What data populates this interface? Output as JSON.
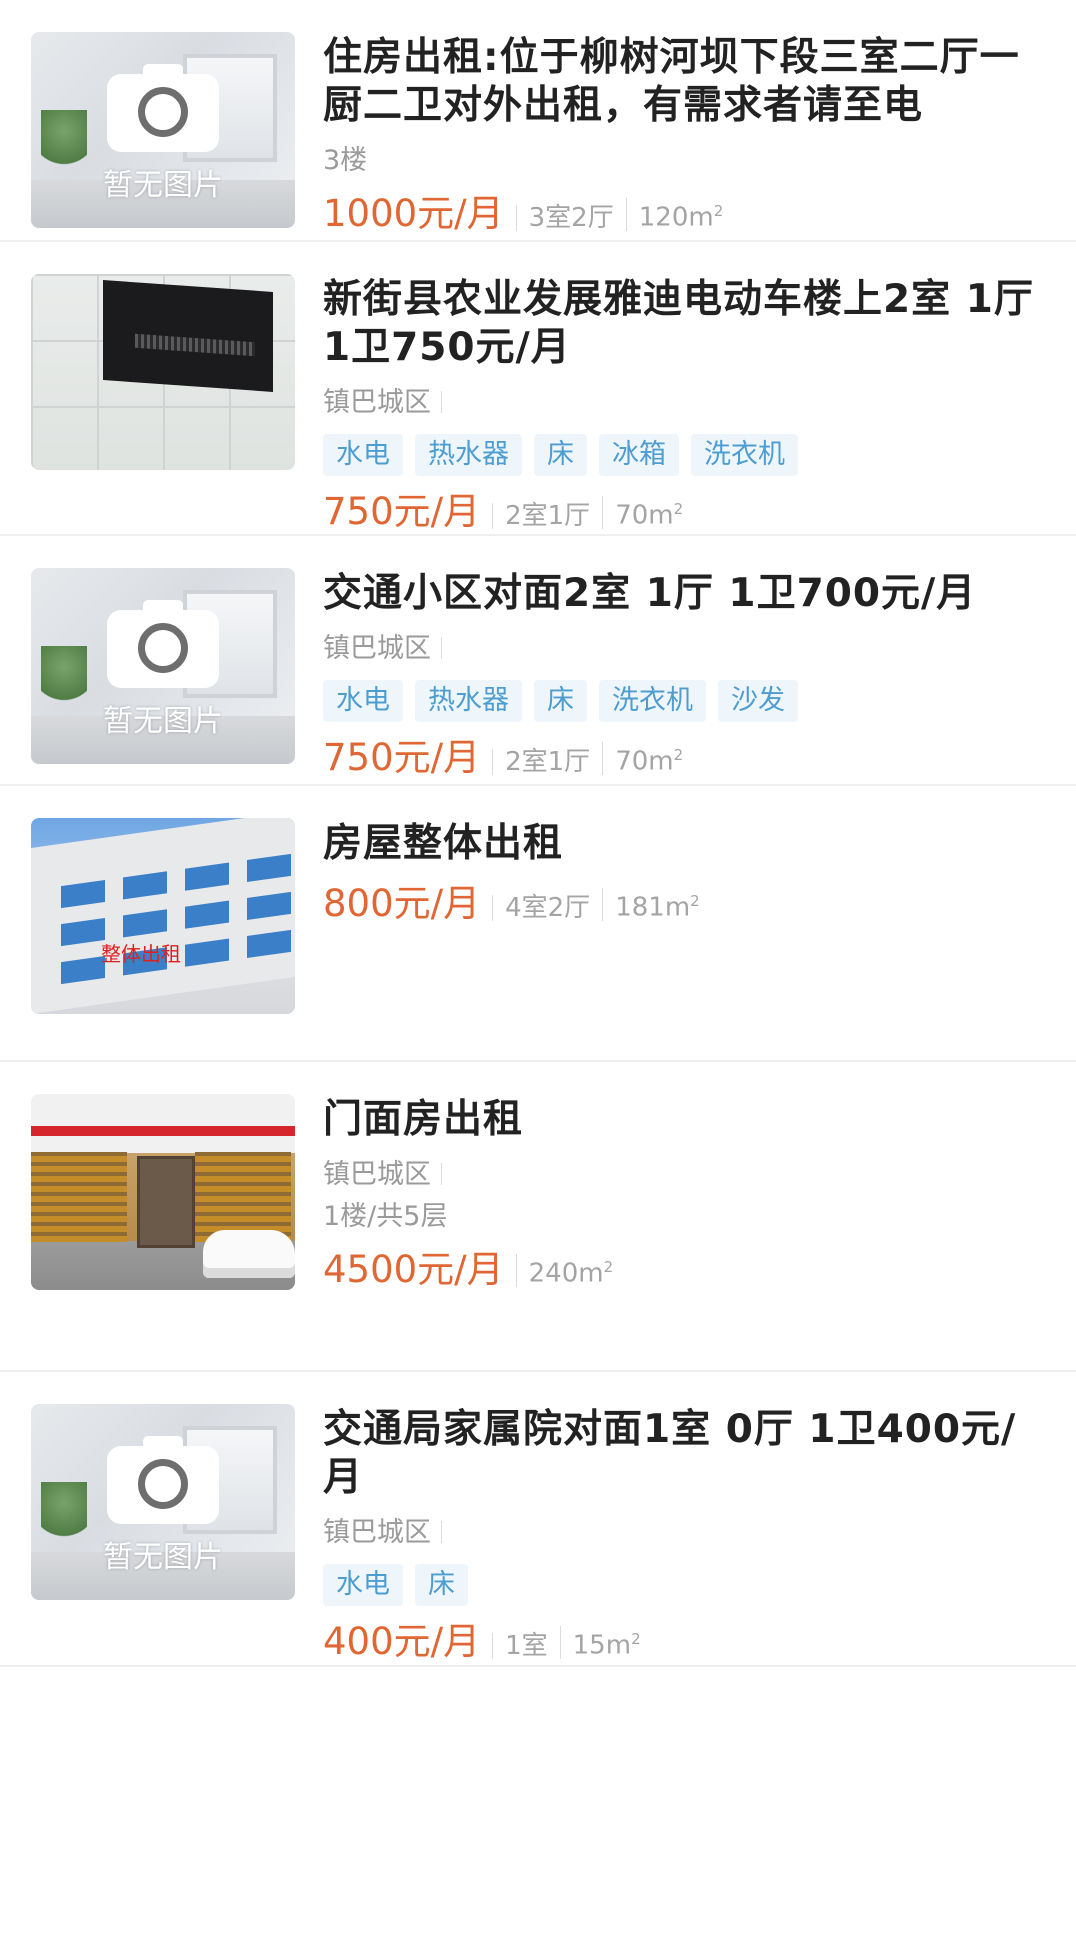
{
  "placeholder_text": "暂无图片",
  "listings": [
    {
      "title": "住房出租:位于柳树河坝下段三室二厅一厨二卫对外出租，有需求者请至电",
      "sub": "3楼",
      "price": "1000元/月",
      "rooms": "3室2厅",
      "area": "120m",
      "area_unit_sup": "2"
    },
    {
      "title": "新街县农业发展雅迪电动车楼上2室 1厅 1卫750元/月",
      "district": "镇巴城区",
      "tags": [
        "水电",
        "热水器",
        "床",
        "冰箱",
        "洗衣机"
      ],
      "price": "750元/月",
      "rooms": "2室1厅",
      "area": "70m",
      "area_unit_sup": "2"
    },
    {
      "title": "交通小区对面2室 1厅 1卫700元/月",
      "district": "镇巴城区",
      "tags": [
        "水电",
        "热水器",
        "床",
        "洗衣机",
        "沙发"
      ],
      "price": "750元/月",
      "rooms": "2室1厅",
      "area": "70m",
      "area_unit_sup": "2"
    },
    {
      "title": "房屋整体出租",
      "price": "800元/月",
      "rooms": "4室2厅",
      "area": "181m",
      "area_unit_sup": "2",
      "photo_sign": "整体出租"
    },
    {
      "title": "门面房出租",
      "district": "镇巴城区",
      "floor": "1楼/共5层",
      "price": "4500元/月",
      "area": "240m",
      "area_unit_sup": "2"
    },
    {
      "title": "交通局家属院对面1室 0厅 1卫400元/月",
      "district": "镇巴城区",
      "tags": [
        "水电",
        "床"
      ],
      "price": "400元/月",
      "rooms": "1室",
      "area": "15m",
      "area_unit_sup": "2"
    }
  ],
  "colors": {
    "price": "#e06733",
    "tag_text": "#4d9dd0",
    "tag_bg": "#eef6fb",
    "muted": "#9a9a9a"
  }
}
